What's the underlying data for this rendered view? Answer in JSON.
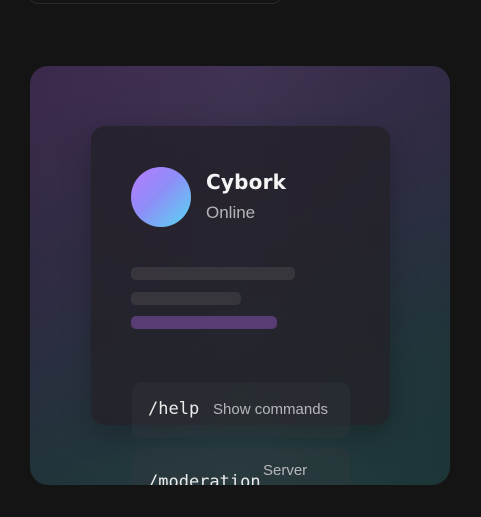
{
  "profile": {
    "name": "Cybork",
    "status": "Online"
  },
  "commands": [
    {
      "name": "/help",
      "description": "Show commands"
    },
    {
      "name": "/moderation",
      "description": "Server"
    }
  ],
  "colors": {
    "background": "#141414",
    "accent_purple": "#b77bff",
    "accent_cyan": "#58d7f3"
  }
}
